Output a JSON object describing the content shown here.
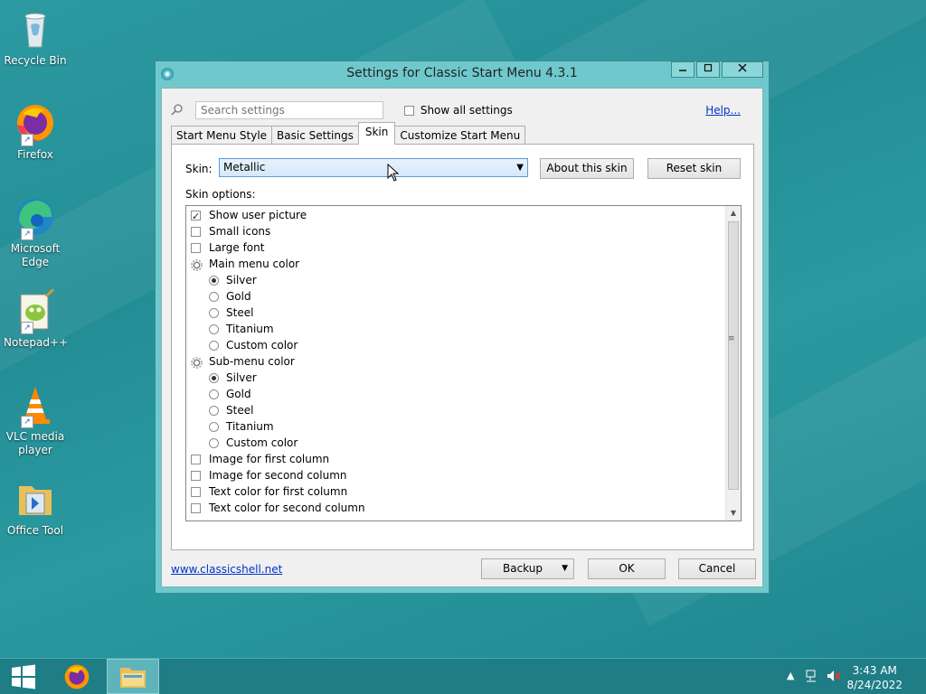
{
  "desktop": {
    "icons": [
      {
        "label": "Recycle Bin",
        "icon": "recycle-bin-icon"
      },
      {
        "label": "Firefox",
        "icon": "firefox-icon"
      },
      {
        "label": "Microsoft Edge",
        "icon": "edge-icon"
      },
      {
        "label": "Notepad++",
        "icon": "notepadpp-icon"
      },
      {
        "label": "VLC media player",
        "icon": "vlc-icon"
      },
      {
        "label": "Office Tool",
        "icon": "office-tool-folder-icon"
      }
    ]
  },
  "dialog": {
    "title": "Settings for Classic Start Menu 4.3.1",
    "search_placeholder": "Search settings",
    "show_all_label": "Show all settings",
    "show_all_checked": false,
    "help_label": "Help...",
    "tabs": [
      {
        "label": "Start Menu Style",
        "active": false
      },
      {
        "label": "Basic Settings",
        "active": false
      },
      {
        "label": "Skin",
        "active": true
      },
      {
        "label": "Customize Start Menu",
        "active": false
      }
    ],
    "skin_label": "Skin:",
    "skin_value": "Metallic",
    "about_skin_label": "About this skin",
    "reset_skin_label": "Reset skin",
    "skin_options_label": "Skin options:",
    "options": [
      {
        "type": "checkbox",
        "label": "Show user picture",
        "checked": true,
        "indent": 0
      },
      {
        "type": "checkbox",
        "label": "Small icons",
        "checked": false,
        "indent": 0
      },
      {
        "type": "checkbox",
        "label": "Large font",
        "checked": false,
        "indent": 0
      },
      {
        "type": "group",
        "label": "Main menu color",
        "indent": 0
      },
      {
        "type": "radio",
        "label": "Silver",
        "checked": true,
        "indent": 1
      },
      {
        "type": "radio",
        "label": "Gold",
        "checked": false,
        "indent": 1
      },
      {
        "type": "radio",
        "label": "Steel",
        "checked": false,
        "indent": 1
      },
      {
        "type": "radio",
        "label": "Titanium",
        "checked": false,
        "indent": 1
      },
      {
        "type": "radio",
        "label": "Custom color",
        "checked": false,
        "indent": 1
      },
      {
        "type": "group",
        "label": "Sub-menu color",
        "indent": 0
      },
      {
        "type": "radio",
        "label": "Silver",
        "checked": true,
        "indent": 1
      },
      {
        "type": "radio",
        "label": "Gold",
        "checked": false,
        "indent": 1
      },
      {
        "type": "radio",
        "label": "Steel",
        "checked": false,
        "indent": 1
      },
      {
        "type": "radio",
        "label": "Titanium",
        "checked": false,
        "indent": 1
      },
      {
        "type": "radio",
        "label": "Custom color",
        "checked": false,
        "indent": 1
      },
      {
        "type": "checkbox",
        "label": "Image for first column",
        "checked": false,
        "indent": 0
      },
      {
        "type": "checkbox",
        "label": "Image for second column",
        "checked": false,
        "indent": 0
      },
      {
        "type": "checkbox",
        "label": "Text color for first column",
        "checked": false,
        "indent": 0
      },
      {
        "type": "checkbox",
        "label": "Text color for second column",
        "checked": false,
        "indent": 0
      }
    ],
    "website_link": "www.classicshell.net",
    "backup_label": "Backup",
    "ok_label": "OK",
    "cancel_label": "Cancel"
  },
  "taskbar": {
    "time": "3:43 AM",
    "date": "8/24/2022"
  },
  "colors": {
    "accent": "#6fc9cc",
    "taskbar": "#1f7d86",
    "link": "#0033cc",
    "select_highlight": "#d5e8fa"
  }
}
